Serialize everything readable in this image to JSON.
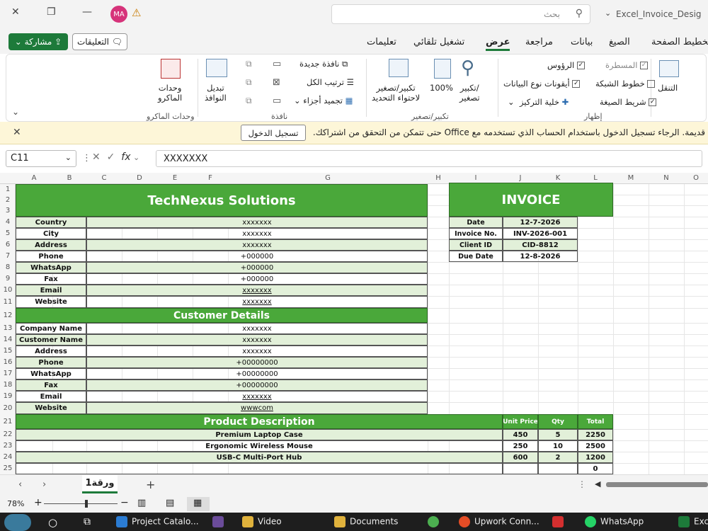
{
  "titlebar": {
    "avatar_initials": "MA",
    "search_placeholder": "بحث",
    "doc_title": "Excel_Invoice_Desig"
  },
  "tabs": [
    {
      "label": "تخطيط الصفحة",
      "active": false
    },
    {
      "label": "الصيغ",
      "active": false
    },
    {
      "label": "بيانات",
      "active": false
    },
    {
      "label": "مراجعة",
      "active": false
    },
    {
      "label": "عرض",
      "active": true
    },
    {
      "label": "تشغيل تلقائي",
      "active": false
    },
    {
      "label": "تعليمات",
      "active": false
    }
  ],
  "share_label": "مشاركة",
  "comments_label": "التعليقات",
  "ribbon": {
    "show_group": {
      "label": "إظهار",
      "ruler": "المسطرة",
      "headings": "الرؤوس",
      "gridlines": "خطوط الشبكة",
      "datatype_icons": "أيقونات نوع البيانات",
      "formula_bar": "شريط الصيغة",
      "focus_cell": "خلية التركيز"
    },
    "navigation": "التنقل",
    "zoom_group": {
      "label": "تكبير/تصغير",
      "zoom": "تكبير/\nتصغير",
      "zoom_100": "100%",
      "zoom_sel": "تكبير/تصغير\nلاحتواء التحديد"
    },
    "window_group": {
      "label": "نافذة",
      "new_window": "نافذة جديدة",
      "arrange_all": "ترتيب الكل",
      "freeze_panes": "تجميد أجزاء",
      "switch_windows": "تبديل\nالنوافذ"
    },
    "macros_group": {
      "label": "وحدات الماكرو",
      "macros": "وحدات\nالماكرو"
    }
  },
  "notice": {
    "text": "قديمة. الرجاء تسجيل الدخول باستخدام الحساب الذي تستخدمه مع Office حتى تتمكن من التحقق من اشتراكك.",
    "signin_label": "تسجيل الدخول"
  },
  "formula_bar": {
    "name_box": "C11",
    "fx": "fx",
    "value": "XXXXXXX"
  },
  "columns": [
    "A",
    "B",
    "C",
    "D",
    "E",
    "F",
    "G",
    "H",
    "I",
    "J",
    "K",
    "L",
    "M",
    "N",
    "O"
  ],
  "rows": [
    "1",
    "2",
    "3",
    "4",
    "5",
    "6",
    "7",
    "8",
    "9",
    "10",
    "11",
    "12",
    "13",
    "14",
    "15",
    "16",
    "17",
    "18",
    "19",
    "20",
    "21",
    "22",
    "23",
    "24",
    "25"
  ],
  "company": {
    "name": "TechNexus Solutions",
    "fields": [
      {
        "label": "Country",
        "value": "xxxxxxx"
      },
      {
        "label": "City",
        "value": "xxxxxxx"
      },
      {
        "label": "Address",
        "value": "xxxxxxx"
      },
      {
        "label": "Phone",
        "value": "+000000"
      },
      {
        "label": "WhatsApp",
        "value": "+000000"
      },
      {
        "label": "Fax",
        "value": "+000000"
      },
      {
        "label": "Email",
        "value": "xxxxxxx"
      },
      {
        "label": "Website",
        "value": "xxxxxxx"
      }
    ]
  },
  "customer": {
    "title": "Customer Details",
    "fields": [
      {
        "label": "Company Name",
        "value": "xxxxxxx"
      },
      {
        "label": "Customer Name",
        "value": "xxxxxxx"
      },
      {
        "label": "Address",
        "value": "xxxxxxx"
      },
      {
        "label": "Phone",
        "value": "+00000000"
      },
      {
        "label": "WhatsApp",
        "value": "+00000000"
      },
      {
        "label": "Fax",
        "value": "+00000000"
      },
      {
        "label": "Email",
        "value": "xxxxxxx"
      },
      {
        "label": "Website",
        "value": "wwwcom"
      }
    ]
  },
  "invoice": {
    "title": "INVOICE",
    "fields": [
      {
        "label": "Date",
        "value": "12-7-2026"
      },
      {
        "label": "Invoice No.",
        "value": "INV-2026-001"
      },
      {
        "label": "Client ID",
        "value": "CID-8812"
      },
      {
        "label": "Due Date",
        "value": "12-8-2026"
      }
    ]
  },
  "products": {
    "title": "Product Description",
    "headers": {
      "unit_price": "Unit Price",
      "qty": "Qty",
      "total": "Total"
    },
    "items": [
      {
        "name": "Premium Laptop Case",
        "unit_price": "450",
        "qty": "5",
        "total": "2250"
      },
      {
        "name": "Ergonomic Wireless Mouse",
        "unit_price": "250",
        "qty": "10",
        "total": "2500"
      },
      {
        "name": "USB-C Multi-Port Hub",
        "unit_price": "600",
        "qty": "2",
        "total": "1200"
      },
      {
        "name": "",
        "unit_price": "",
        "qty": "",
        "total": "0"
      }
    ]
  },
  "sheet_tab": "ورقة1",
  "status": {
    "zoom": "78%"
  },
  "taskbar": [
    {
      "label": "Project Catalo...",
      "color": "#2b7cd3"
    },
    {
      "label": "Video",
      "color": "#e0b23c"
    },
    {
      "label": "Documents",
      "color": "#e0b23c"
    },
    {
      "label": "Upwork Conn...",
      "color": "#4caf50"
    },
    {
      "label": "WhatsApp",
      "color": "#25d366"
    },
    {
      "label": "Exc",
      "color": "#1d7a3a"
    }
  ]
}
